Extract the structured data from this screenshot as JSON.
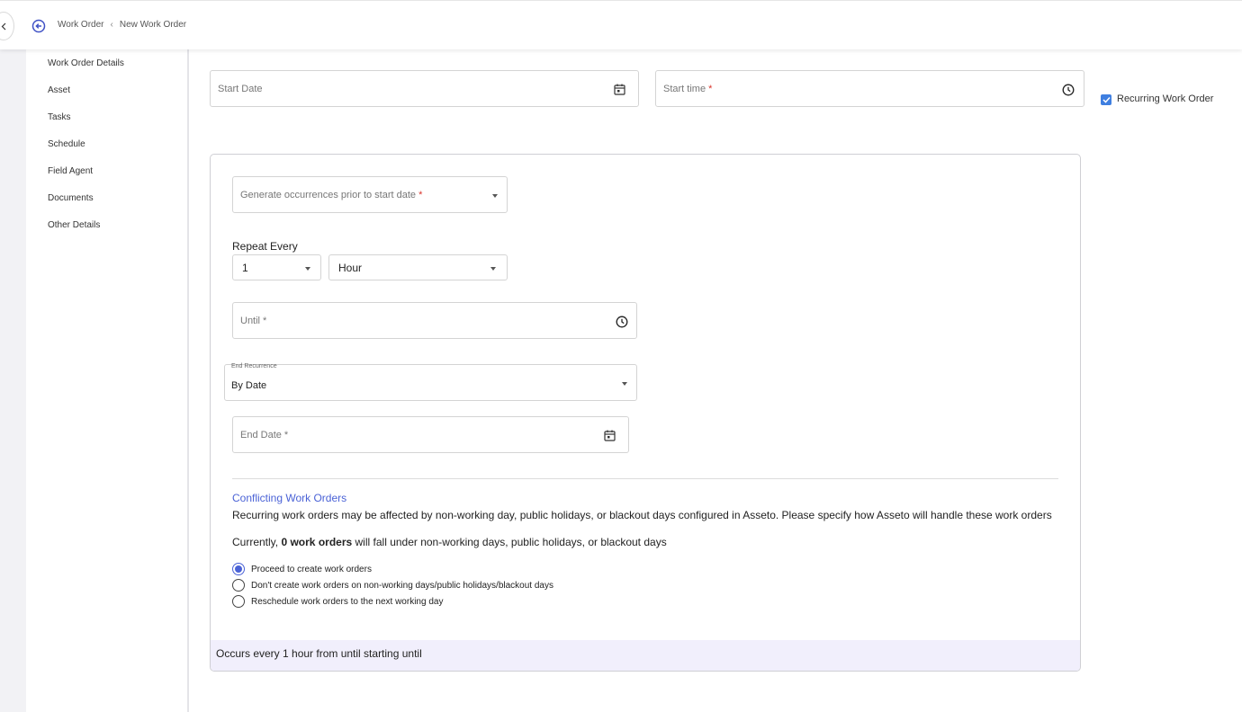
{
  "header": {
    "breadcrumb": {
      "parent": "Work Order",
      "current": "New Work Order"
    }
  },
  "sidebar": {
    "items": [
      {
        "label": "Work Order Details"
      },
      {
        "label": "Asset"
      },
      {
        "label": "Tasks"
      },
      {
        "label": "Schedule"
      },
      {
        "label": "Field Agent"
      },
      {
        "label": "Documents"
      },
      {
        "label": "Other Details"
      }
    ]
  },
  "schedule": {
    "start_date": {
      "placeholder": "Start Date"
    },
    "start_time": {
      "placeholder": "Start time",
      "required_mark": "*"
    },
    "recurring": {
      "label": "Recurring Work Order",
      "checked": true
    },
    "generate_occurrences": {
      "placeholder": "Generate occurrences prior to start date",
      "required_mark": "*"
    },
    "repeat_every": {
      "label": "Repeat Every",
      "count": "1",
      "unit": "Hour"
    },
    "until": {
      "placeholder": "Until *"
    },
    "end_recurrence": {
      "label": "End Recurrence",
      "value": "By Date"
    },
    "end_date": {
      "placeholder": "End Date *"
    }
  },
  "conflicts": {
    "title": "Conflicting Work Orders",
    "description": "Recurring work orders may be affected by non-working day, public holidays, or blackout days configured in Asseto. Please specify how Asseto will handle these work orders",
    "current_prefix": "Currently,",
    "current_count": "0 work orders",
    "current_suffix": "will fall under non-working days, public holidays, or blackout days",
    "options": [
      {
        "label": "Proceed to create work orders",
        "selected": true
      },
      {
        "label": "Don't create work orders on non-working days/public holidays/blackout days",
        "selected": false
      },
      {
        "label": "Reschedule work orders to the next working day",
        "selected": false
      }
    ]
  },
  "summary": {
    "text": "Occurs every 1 hour from until starting until"
  },
  "colors": {
    "accent": "#4a62d6",
    "checkbox": "#3f7fe0",
    "summary_bg": "#f1effc",
    "required": "#d9342b"
  }
}
